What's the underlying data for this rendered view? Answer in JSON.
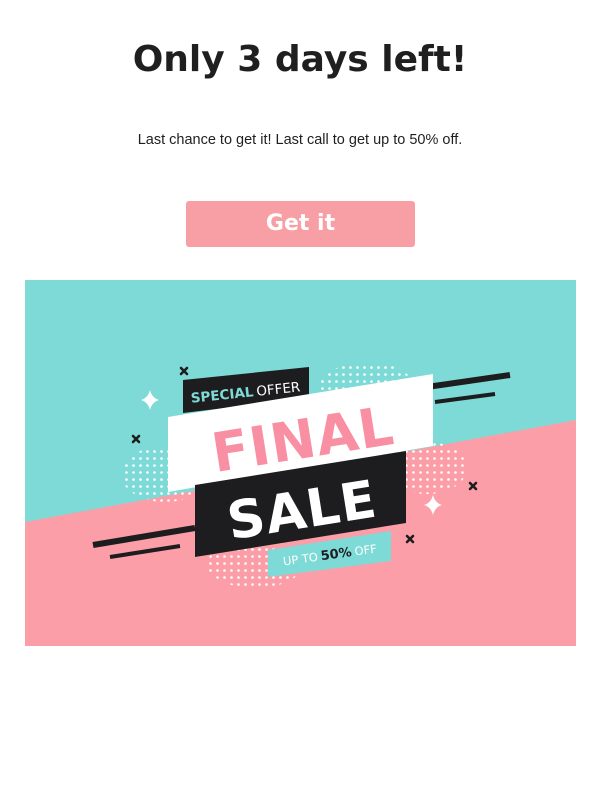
{
  "email": {
    "headline": "Only 3 days left!",
    "subline": "Last chance to get it! Last call to get up to 50% off.",
    "cta_label": "Get it"
  },
  "banner": {
    "special_word": "SPECIAL",
    "offer_word": "OFFER",
    "final_word": "FINAL",
    "sale_word": "SALE",
    "upto_prefix": "UP TO",
    "upto_percent": "50%",
    "upto_suffix": "OFF",
    "colors": {
      "teal": "#7ddad6",
      "pink": "#fc9ea8",
      "dark": "#1d1d1f",
      "white": "#ffffff",
      "final_text": "#f98fa3"
    }
  }
}
